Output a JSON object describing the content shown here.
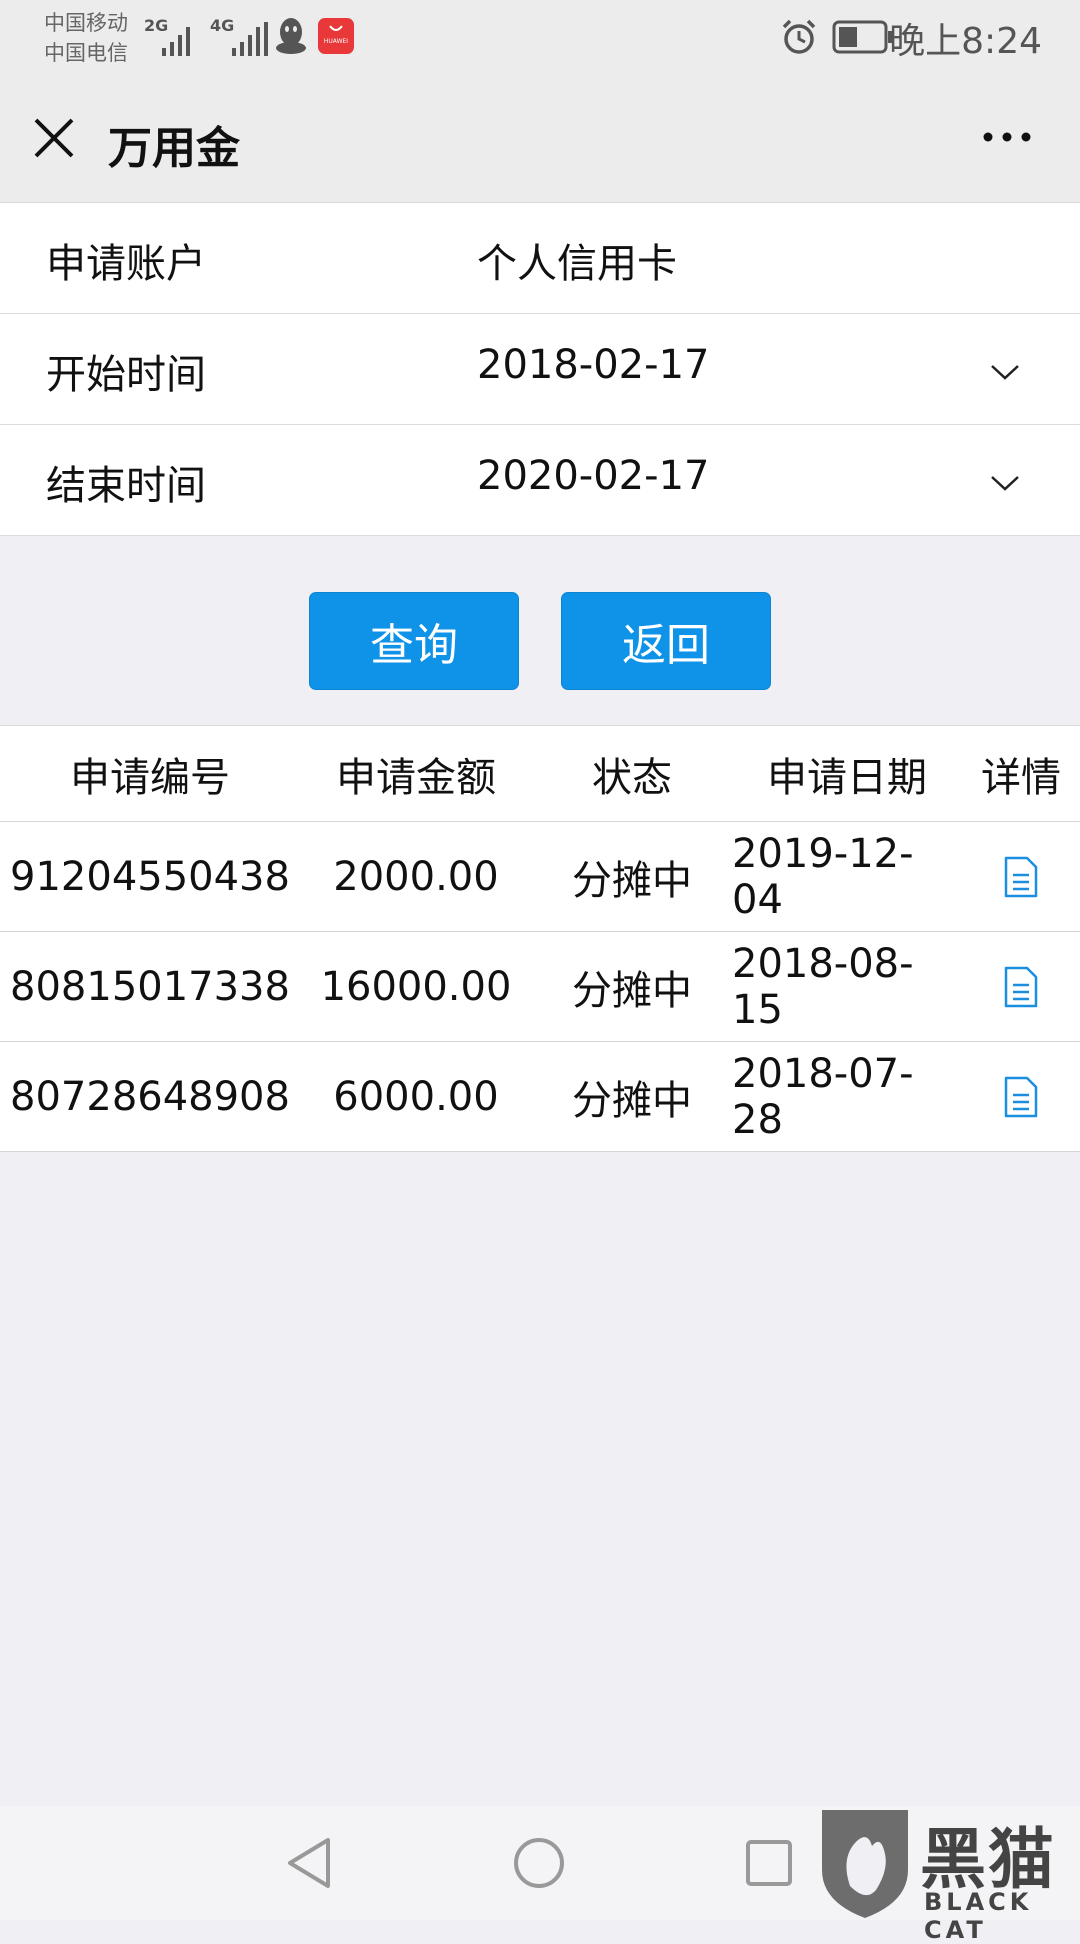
{
  "status_bar": {
    "carrier_1": "中国移动",
    "carrier_2": "中国电信",
    "net_1": "2G",
    "net_2": "4G",
    "app_badge_label": "HUAWEI",
    "time": "晚上8:24",
    "icons": [
      "signal-icon",
      "qq-icon",
      "huawei-appgallery-icon",
      "alarm-icon",
      "battery-icon"
    ]
  },
  "nav": {
    "title": "万用金",
    "close_icon": "close-icon",
    "more_icon": "more-icon"
  },
  "form": {
    "account_label": "申请账户",
    "account_value": "个人信用卡",
    "start_label": "开始时间",
    "start_value": "2018-02-17",
    "end_label": "结束时间",
    "end_value": "2020-02-17"
  },
  "buttons": {
    "query": "查询",
    "back": "返回"
  },
  "table": {
    "headers": [
      "申请编号",
      "申请金额",
      "状态",
      "申请日期",
      "详情"
    ],
    "rows": [
      {
        "id": "91204550438",
        "amount": "2000.00",
        "status": "分摊中",
        "date": "2019-12-04"
      },
      {
        "id": "80815017338",
        "amount": "16000.00",
        "status": "分摊中",
        "date": "2018-08-15"
      },
      {
        "id": "80728648908",
        "amount": "6000.00",
        "status": "分摊中",
        "date": "2018-07-28"
      }
    ]
  },
  "watermark": {
    "text": "黑猫",
    "sub": "BLACK CAT"
  },
  "colors": {
    "accent": "#0e93e8",
    "background": "#efeff4"
  }
}
